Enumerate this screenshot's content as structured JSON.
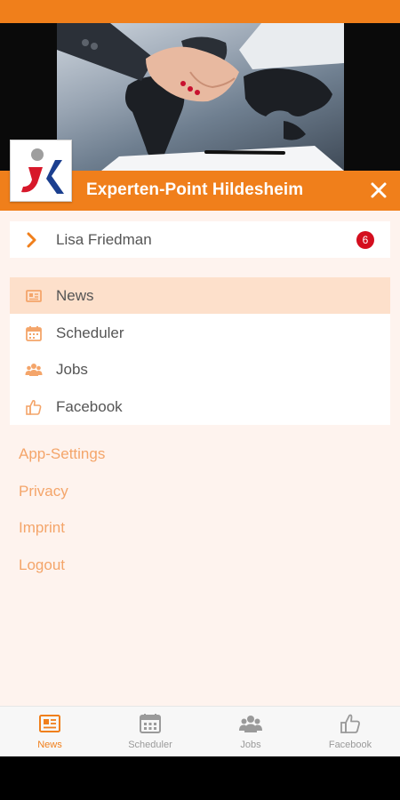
{
  "colors": {
    "brand": "#F07F1B",
    "drawer_bg": "#FEF3EE",
    "active_bg": "#FDE0CB",
    "badge": "#D40E1E",
    "link": "#F4A56A"
  },
  "header": {
    "title": "Experten-Point Hildesheim",
    "close_icon": "close-icon",
    "logo": "company-logo"
  },
  "user": {
    "name": "Lisa Friedman",
    "badge_count": "6",
    "icon": "chevron-right-icon"
  },
  "menu": {
    "items": [
      {
        "label": "News",
        "icon": "newspaper-icon",
        "active": true
      },
      {
        "label": "Scheduler",
        "icon": "calendar-icon",
        "active": false
      },
      {
        "label": "Jobs",
        "icon": "group-icon",
        "active": false
      },
      {
        "label": "Facebook",
        "icon": "thumbs-up-icon",
        "active": false
      }
    ]
  },
  "links": {
    "app_settings": "App-Settings",
    "privacy": "Privacy",
    "imprint": "Imprint",
    "logout": "Logout"
  },
  "bottom_nav": {
    "tabs": [
      {
        "label": "News",
        "icon": "newspaper-icon",
        "active": true
      },
      {
        "label": "Scheduler",
        "icon": "calendar-icon",
        "active": false
      },
      {
        "label": "Jobs",
        "icon": "group-icon",
        "active": false
      },
      {
        "label": "Facebook",
        "icon": "thumbs-up-icon",
        "active": false
      }
    ]
  }
}
